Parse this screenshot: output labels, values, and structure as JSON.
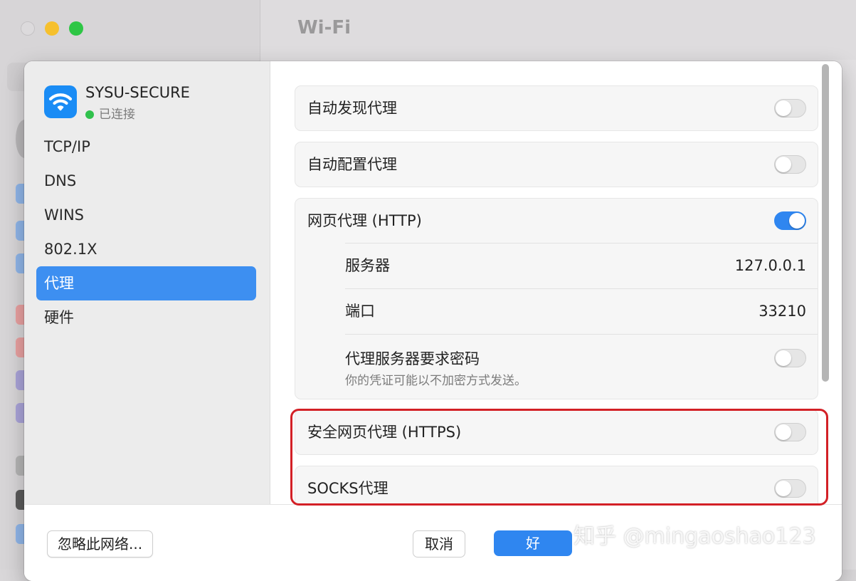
{
  "background_window": {
    "title": "Wi-Fi"
  },
  "network": {
    "name": "SYSU-SECURE",
    "status": "已连接",
    "icon": "wifi-icon"
  },
  "sidebar": {
    "items": [
      {
        "label": "TCP/IP",
        "selected": false
      },
      {
        "label": "DNS",
        "selected": false
      },
      {
        "label": "WINS",
        "selected": false
      },
      {
        "label": "802.1X",
        "selected": false
      },
      {
        "label": "代理",
        "selected": true
      },
      {
        "label": "硬件",
        "selected": false
      }
    ]
  },
  "proxies": {
    "auto_discovery": {
      "label": "自动发现代理",
      "enabled": false
    },
    "auto_config": {
      "label": "自动配置代理",
      "enabled": false
    },
    "http": {
      "label": "网页代理 (HTTP)",
      "enabled": true,
      "server_label": "服务器",
      "server_value": "127.0.0.1",
      "port_label": "端口",
      "port_value": "33210",
      "password_label": "代理服务器要求密码",
      "password_hint": "你的凭证可能以不加密方式发送。",
      "password_required": false
    },
    "https": {
      "label": "安全网页代理 (HTTPS)",
      "enabled": false
    },
    "socks": {
      "label": "SOCKS代理",
      "enabled": false
    }
  },
  "footer": {
    "forget_label": "忽略此网络...",
    "cancel_label": "取消",
    "ok_label": "好"
  },
  "watermark": "知乎 @mingaoshao123",
  "colors": {
    "accent": "#2f86f0",
    "highlight": "#d32026",
    "connected": "#30c14c"
  }
}
